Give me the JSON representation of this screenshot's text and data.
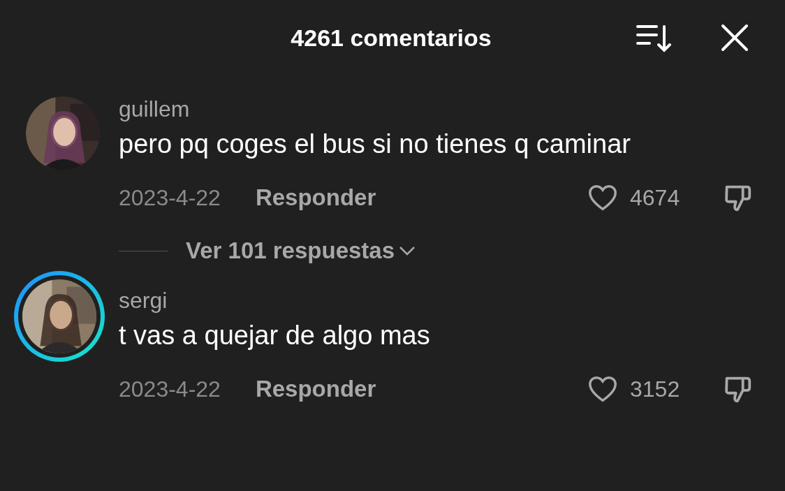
{
  "header": {
    "title": "4261 comentarios"
  },
  "comments": [
    {
      "user": "guillem",
      "text": "pero pq coges el bus si no tienes q caminar",
      "date": "2023-4-22",
      "reply_label": "Responder",
      "likes": "4674",
      "liked": false,
      "story_ring": false,
      "replies_link": "Ver 101 respuestas"
    },
    {
      "user": "sergi",
      "text": "t vas a quejar de algo mas",
      "date": "2023-4-22",
      "reply_label": "Responder",
      "likes": "3152",
      "liked": false,
      "story_ring": true
    }
  ]
}
